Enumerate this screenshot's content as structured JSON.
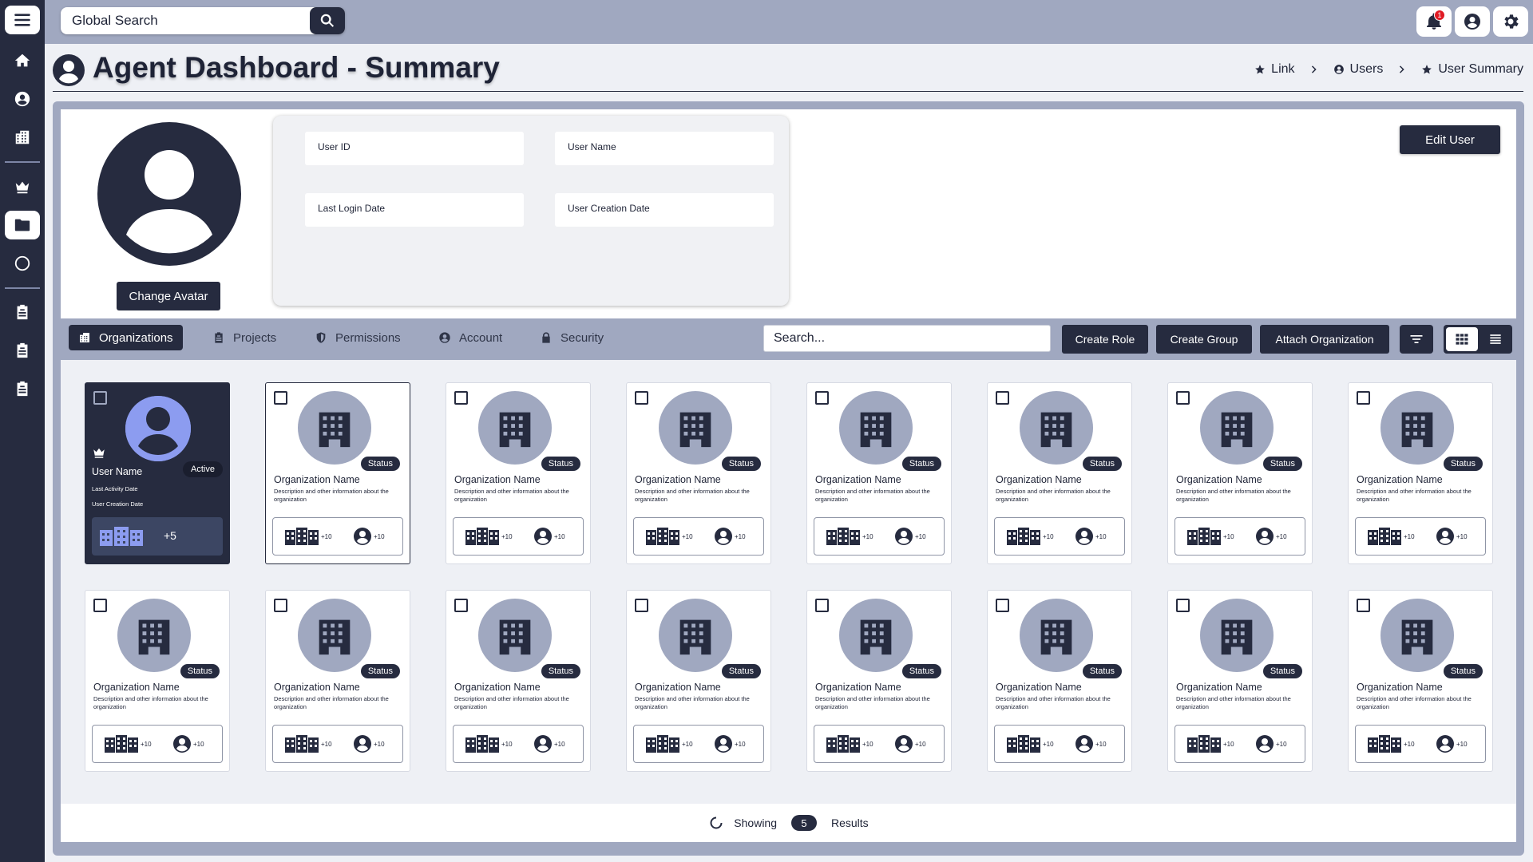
{
  "topbar": {
    "search_placeholder": "Global Search",
    "notification_count": "1"
  },
  "header": {
    "title": "Agent Dashboard - Summary",
    "breadcrumb": [
      {
        "label": "Link",
        "icon": "star-icon"
      },
      {
        "label": "Users",
        "icon": "user-circle-icon"
      },
      {
        "label": "User Summary",
        "icon": "star-icon"
      }
    ]
  },
  "profile": {
    "change_avatar_label": "Change Avatar",
    "edit_user_label": "Edit User",
    "fields": {
      "user_id": {
        "label": "User ID",
        "value": ""
      },
      "user_name": {
        "label": "User Name",
        "value": ""
      },
      "last_login": {
        "label": "Last Login Date",
        "value": ""
      },
      "creation_date": {
        "label": "User Creation Date",
        "value": ""
      }
    }
  },
  "tabs": [
    {
      "label": "Organizations",
      "icon": "building-icon",
      "active": true
    },
    {
      "label": "Projects",
      "icon": "clipboard-icon",
      "active": false
    },
    {
      "label": "Permissions",
      "icon": "shield-icon",
      "active": false
    },
    {
      "label": "Account",
      "icon": "user-circle-icon",
      "active": false
    },
    {
      "label": "Security",
      "icon": "lock-icon",
      "active": false
    }
  ],
  "toolbar": {
    "search_placeholder": "Search...",
    "create_role": "Create Role",
    "create_group": "Create Group",
    "attach_organization": "Attach Organization"
  },
  "user_card": {
    "name": "User Name",
    "status": "Active",
    "last_activity": "Last Activity Date",
    "creation_date": "User Creation Date",
    "org_count": "+5"
  },
  "org_card": {
    "status": "Status",
    "name": "Organization Name",
    "description": "Description and other information about the organization",
    "org_count": "+10",
    "user_count": "+10"
  },
  "results": {
    "prefix": "Showing",
    "count": "5",
    "suffix": "Results"
  },
  "colors": {
    "primary": "#262b3f",
    "accent": "#a0a8c0",
    "avatar_accent": "#8c9cf0",
    "badge": "#e01b24"
  }
}
